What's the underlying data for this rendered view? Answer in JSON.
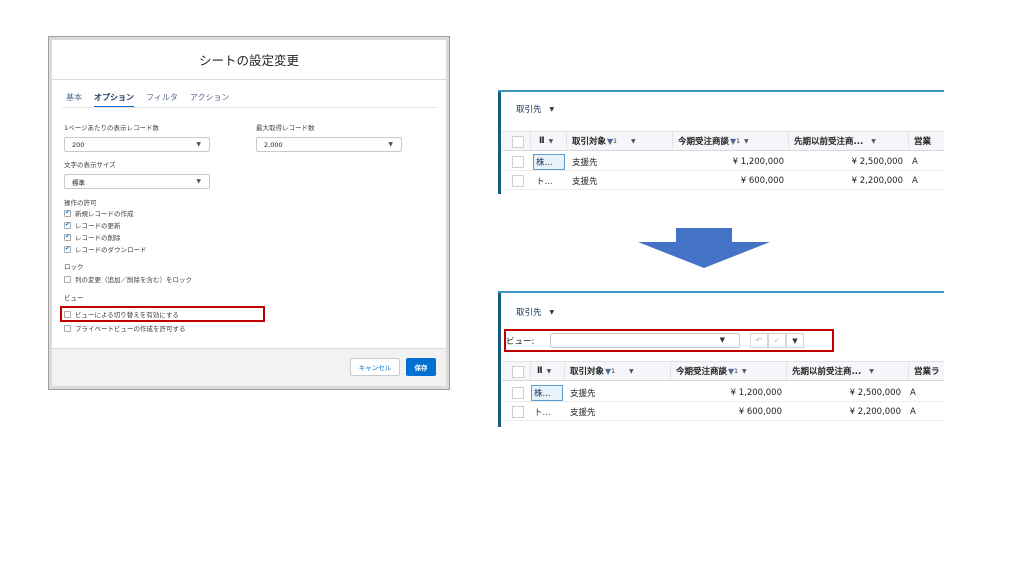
{
  "modal": {
    "title": "シートの設定変更",
    "tabs": [
      "基本",
      "オプション",
      "フィルタ",
      "アクション"
    ],
    "active_tab": "オプション",
    "records_per_page_label": "1ページあたりの表示レコード数",
    "records_per_page_value": "200",
    "max_records_label": "最大取得レコード数",
    "max_records_value": "2,000",
    "text_size_label": "文字の表示サイズ",
    "text_size_value": "標準",
    "permissions_label": "操作の許可",
    "permissions": [
      {
        "label": "新規レコードの作成",
        "checked": true
      },
      {
        "label": "レコードの更新",
        "checked": true
      },
      {
        "label": "レコードの削除",
        "checked": true
      },
      {
        "label": "レコードのダウンロード",
        "checked": true
      }
    ],
    "lock_label": "ロック",
    "lock_option": {
      "label": "列の変更（追加／削除を含む）をロック",
      "checked": false
    },
    "view_label": "ビュー",
    "view_options": [
      {
        "label": "ビューによる切り替えを有効にする",
        "checked": false
      },
      {
        "label": "プライベートビューの作成を許可する",
        "checked": false
      }
    ],
    "cancel_label": "キャンセル",
    "save_label": "保存"
  },
  "grid_before": {
    "object": "取引先",
    "columns": [
      "取引対象",
      "今期受注商談",
      "先期以前受注商...",
      "営業"
    ],
    "filter_sub": "1",
    "rows": [
      {
        "name": "株...",
        "type": "支援先",
        "current": "¥ 1,200,000",
        "previous": "¥ 2,500,000",
        "extra": "A"
      },
      {
        "name": "ト...",
        "type": "支援先",
        "current": "¥ 600,000",
        "previous": "¥ 2,200,000",
        "extra": "A"
      }
    ]
  },
  "grid_after": {
    "object": "取引先",
    "view_label": "ビュー:",
    "columns": [
      "取引対象",
      "今期受注商談",
      "先期以前受注商...",
      "営業ラ"
    ],
    "filter_sub": "1",
    "rows": [
      {
        "name": "株...",
        "type": "支援先",
        "current": "¥ 1,200,000",
        "previous": "¥ 2,500,000",
        "extra": "A"
      },
      {
        "name": "ト...",
        "type": "支援先",
        "current": "¥ 600,000",
        "previous": "¥ 2,200,000",
        "extra": "A"
      }
    ]
  },
  "colors": {
    "accent": "#0070d2",
    "highlight": "#c00000",
    "arrow": "#4472c4",
    "grid_bar": "#3f97c6"
  }
}
